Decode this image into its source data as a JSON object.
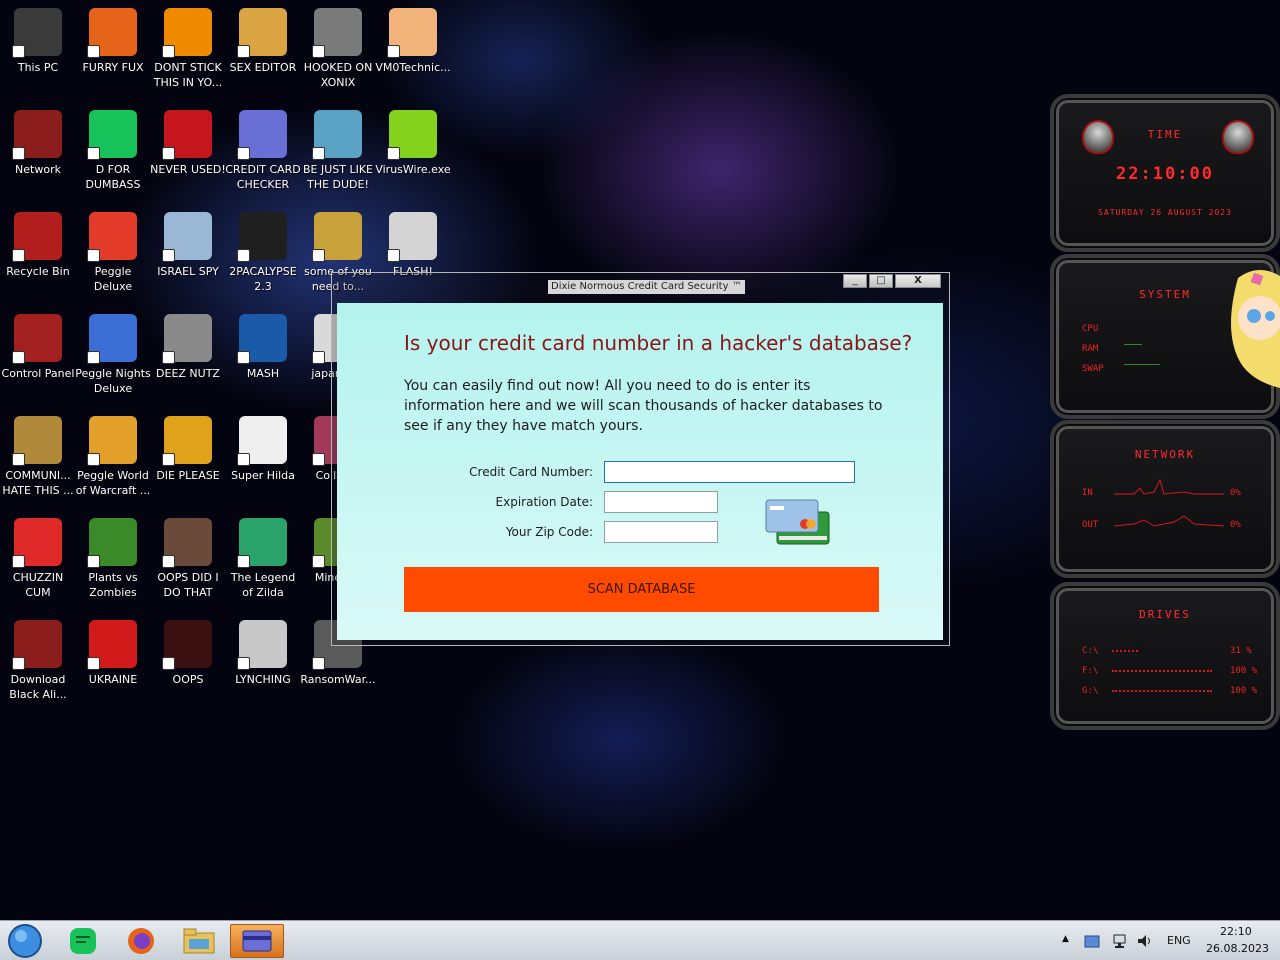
{
  "desktop": {
    "icons": [
      {
        "label": "This PC",
        "icon": "this-pc-icon",
        "color": "#3a3a3a"
      },
      {
        "label": "FURRY FUX",
        "icon": "firefox-icon",
        "color": "#e5641a"
      },
      {
        "label": "DONT STICK THIS IN YO...",
        "icon": "vlc-cone-icon",
        "color": "#f08a00"
      },
      {
        "label": "SEX EDITOR",
        "icon": "hex-editor-icon",
        "color": "#d9a441"
      },
      {
        "label": "HOOKED ON XONIX",
        "icon": "xonix-icon",
        "color": "#7a7a7a"
      },
      {
        "label": "VM0Technic...",
        "icon": "doctor-icon",
        "color": "#f2b37a"
      },
      {
        "label": "Network",
        "icon": "alien-network-icon",
        "color": "#8b1d1d"
      },
      {
        "label": "D FOR DUMBASS",
        "icon": "green-chat-icon",
        "color": "#18c25a"
      },
      {
        "label": "NEVER USED!",
        "icon": "devcpp-icon",
        "color": "#c4161c"
      },
      {
        "label": "CREDIT CARD CHECKER",
        "icon": "credit-card-icon",
        "color": "#6a6fd6"
      },
      {
        "label": "BE JUST LIKE THE DUDE!",
        "icon": "dude-icon",
        "color": "#5aa3c4"
      },
      {
        "label": "VirusWire.exe",
        "icon": "lime-icon",
        "color": "#84d11e"
      },
      {
        "label": "Recycle Bin",
        "icon": "recycle-bin-icon",
        "color": "#b21e1e"
      },
      {
        "label": "Peggle Deluxe",
        "icon": "peggle-icon",
        "color": "#e23b2a"
      },
      {
        "label": "ISRAEL SPY",
        "icon": "spy-network-icon",
        "color": "#9ab8d6"
      },
      {
        "label": "2PACALYPSE 2.3",
        "icon": "terminal-icon",
        "color": "#1f1f1f"
      },
      {
        "label": "some of you need to...",
        "icon": "pixel-beaver-icon",
        "color": "#c8a13a"
      },
      {
        "label": "FLASH!",
        "icon": "flash-icon",
        "color": "#d4d4d4"
      },
      {
        "label": "Control Panel",
        "icon": "control-panel-icon",
        "color": "#a32020"
      },
      {
        "label": "Peggle Nights Deluxe",
        "icon": "peggle-nights-icon",
        "color": "#3b6fd6"
      },
      {
        "label": "DEEZ NUTZ",
        "icon": "stacked-windows-icon",
        "color": "#8a8a8a"
      },
      {
        "label": "MASH",
        "icon": "hat-icon",
        "color": "#1a5aa8"
      },
      {
        "label": "japan si...",
        "icon": "japan-icon",
        "color": "#d9d9d9"
      },
      {
        "label": "COMMUNI... HATE THIS ...",
        "icon": "money-bag-icon",
        "color": "#b08a3a"
      },
      {
        "label": "Peggle World of Warcraft ...",
        "icon": "peggle-wow-icon",
        "color": "#e2a02a"
      },
      {
        "label": "DIE PLEASE",
        "icon": "de-icon",
        "color": "#e0a21a"
      },
      {
        "label": "Super Hilda",
        "icon": "pixel-fox-icon",
        "color": "#efefef"
      },
      {
        "label": "Collab...",
        "icon": "collab-icon",
        "color": "#a33a5a"
      },
      {
        "label": "CHUZZIN CUM",
        "icon": "chuzzle-icon",
        "color": "#e02a2a"
      },
      {
        "label": "Plants vs Zombies",
        "icon": "flower-icon",
        "color": "#3a8a2a"
      },
      {
        "label": "OOPS DID I DO THAT",
        "icon": "portrait-icon",
        "color": "#6a4a3a"
      },
      {
        "label": "The Legend of Zilda",
        "icon": "pixel-hero-icon",
        "color": "#2aa36a"
      },
      {
        "label": "Minecr...",
        "icon": "minecraft-icon",
        "color": "#5a8a2a"
      },
      {
        "label": "Download Black Ali...",
        "icon": "alien-download-icon",
        "color": "#8b1d1d"
      },
      {
        "label": "UKRAINE",
        "icon": "radiation-icon",
        "color": "#d21a1a"
      },
      {
        "label": "OOPS",
        "icon": "red-book-icon",
        "color": "#3a1010"
      },
      {
        "label": "LYNCHING",
        "icon": "emblem-icon",
        "color": "#c8c8c8"
      },
      {
        "label": "RansomWar...",
        "icon": "skull-icon",
        "color": "#5a5a5a"
      }
    ]
  },
  "window": {
    "title": "Dixie Normous Credit Card Security ™",
    "controls": {
      "minimize": "_",
      "maximize": "□",
      "close": "X"
    }
  },
  "dialog": {
    "heading": "Is your credit card number in a hacker's database?",
    "description": "You can easily find out now! All you need to do is enter its information here and we will scan thousands of hacker databases to see if any they have match yours.",
    "fields": {
      "card_number": {
        "label": "Credit Card Number:",
        "value": ""
      },
      "expiration": {
        "label": "Expiration Date:",
        "value": ""
      },
      "zip": {
        "label": "Your Zip Code:",
        "value": ""
      }
    },
    "scan_button": "SCAN DATABASE",
    "heading_color": "#8b1515",
    "button_color": "#ff4b00"
  },
  "widgets": {
    "time": {
      "title": "TIME",
      "clock": "22:10:00",
      "date": "SATURDAY 26 AUGUST 2023"
    },
    "system": {
      "title": "SYSTEM",
      "rows": [
        "CPU",
        "RAM",
        "SWAP"
      ]
    },
    "network": {
      "title": "NETWORK",
      "in_label": "IN",
      "out_label": "OUT",
      "in_value": "0%",
      "out_value": "0%"
    },
    "drives": {
      "title": "DRIVES",
      "rows": [
        {
          "name": "C:\\",
          "value": "31 %"
        },
        {
          "name": "F:\\",
          "value": "100 %"
        },
        {
          "name": "G:\\",
          "value": "100 %"
        }
      ]
    }
  },
  "taskbar": {
    "language": "ENG",
    "time": "22:10",
    "date": "26.08.2023"
  }
}
